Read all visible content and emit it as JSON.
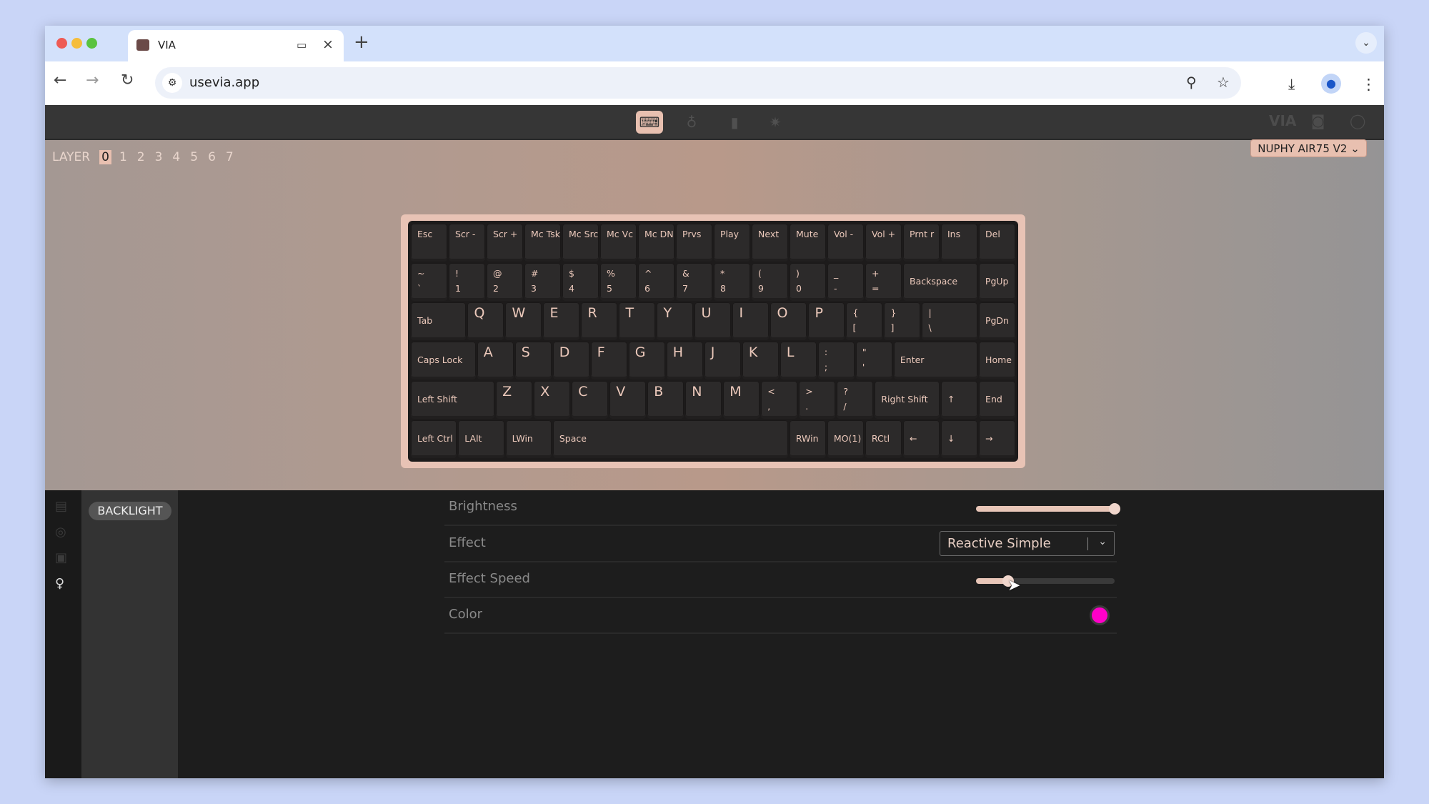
{
  "browser": {
    "tab_title": "VIA",
    "url": "usevia.app",
    "icons": {
      "new_tab": "+",
      "close": "×",
      "back": "←",
      "forward": "→",
      "reload": "↻",
      "zoom": "⚲",
      "star": "☆",
      "download": "⤓",
      "menu": "⋮",
      "tab_search": "⌄",
      "pip": "▭"
    }
  },
  "app": {
    "header_icons": [
      "keyboard-icon",
      "microphone-icon",
      "design-icon",
      "gear-icon"
    ],
    "right_labels": {
      "via": "VIA",
      "discord": "◙",
      "github": "◯"
    },
    "layer_label": "LAYER",
    "layers": [
      "0",
      "1",
      "2",
      "3",
      "4",
      "5",
      "6",
      "7"
    ],
    "active_layer": "0",
    "device": "NUPHY AIR75 V2 ⌄"
  },
  "keyboard": {
    "rows": [
      [
        {
          "t": "Esc"
        },
        {
          "t": "Scr -"
        },
        {
          "t": "Scr +"
        },
        {
          "t": "Mc Tsk"
        },
        {
          "t": "Mc Src"
        },
        {
          "t": "Mc Vc"
        },
        {
          "t": "Mc DN"
        },
        {
          "t": "Prvs"
        },
        {
          "t": "Play"
        },
        {
          "t": "Next"
        },
        {
          "t": "Mute"
        },
        {
          "t": "Vol -"
        },
        {
          "t": "Vol +"
        },
        {
          "t": "Prnt r"
        },
        {
          "t": "Ins"
        },
        {
          "t": "Del"
        }
      ],
      [
        {
          "t": "~",
          "b": "`"
        },
        {
          "t": "!",
          "b": "1"
        },
        {
          "t": "@",
          "b": "2"
        },
        {
          "t": "#",
          "b": "3"
        },
        {
          "t": "$",
          "b": "4"
        },
        {
          "t": "%",
          "b": "5"
        },
        {
          "t": "^",
          "b": "6"
        },
        {
          "t": "&",
          "b": "7"
        },
        {
          "t": "*",
          "b": "8"
        },
        {
          "t": "(",
          "b": "9"
        },
        {
          "t": ")",
          "b": "0"
        },
        {
          "t": "_",
          "b": "-"
        },
        {
          "t": "+",
          "b": "="
        },
        {
          "t": "Backspace",
          "w": 2
        },
        {
          "t": "PgUp"
        }
      ],
      [
        {
          "t": "Tab",
          "w": 1.5
        },
        {
          "t": "Q",
          "big": 1
        },
        {
          "t": "W",
          "big": 1
        },
        {
          "t": "E",
          "big": 1
        },
        {
          "t": "R",
          "big": 1
        },
        {
          "t": "T",
          "big": 1
        },
        {
          "t": "Y",
          "big": 1
        },
        {
          "t": "U",
          "big": 1
        },
        {
          "t": "I",
          "big": 1
        },
        {
          "t": "O",
          "big": 1
        },
        {
          "t": "P",
          "big": 1
        },
        {
          "t": "{",
          "b": "["
        },
        {
          "t": "}",
          "b": "]"
        },
        {
          "t": "|",
          "b": "\\",
          "w": 1.5
        },
        {
          "t": "PgDn"
        }
      ],
      [
        {
          "t": "Caps Lock",
          "w": 1.75
        },
        {
          "t": "A",
          "big": 1
        },
        {
          "t": "S",
          "big": 1
        },
        {
          "t": "D",
          "big": 1
        },
        {
          "t": "F",
          "big": 1
        },
        {
          "t": "G",
          "big": 1
        },
        {
          "t": "H",
          "big": 1
        },
        {
          "t": "J",
          "big": 1
        },
        {
          "t": "K",
          "big": 1
        },
        {
          "t": "L",
          "big": 1
        },
        {
          "t": ":",
          "b": ";"
        },
        {
          "t": "\"",
          "b": "'"
        },
        {
          "t": "Enter",
          "w": 2.25
        },
        {
          "t": "Home"
        }
      ],
      [
        {
          "t": "Left Shift",
          "w": 2.25
        },
        {
          "t": "Z",
          "big": 1
        },
        {
          "t": "X",
          "big": 1
        },
        {
          "t": "C",
          "big": 1
        },
        {
          "t": "V",
          "big": 1
        },
        {
          "t": "B",
          "big": 1
        },
        {
          "t": "N",
          "big": 1
        },
        {
          "t": "M",
          "big": 1
        },
        {
          "t": "<",
          "b": ","
        },
        {
          "t": ">",
          "b": "."
        },
        {
          "t": "?",
          "b": "/"
        },
        {
          "t": "Right Shift",
          "w": 1.75
        },
        {
          "t": "↑"
        },
        {
          "t": "End"
        }
      ],
      [
        {
          "t": "Left Ctrl",
          "w": 1.25
        },
        {
          "t": "LAlt",
          "w": 1.25
        },
        {
          "t": "LWin",
          "w": 1.25
        },
        {
          "t": "Space",
          "w": 6.25
        },
        {
          "t": "RWin"
        },
        {
          "t": "MO(1)"
        },
        {
          "t": "RCtl"
        },
        {
          "t": "←"
        },
        {
          "t": "↓"
        },
        {
          "t": "→"
        }
      ]
    ]
  },
  "panel": {
    "rail_icons": [
      "keymap-icon",
      "macro-icon",
      "save-icon",
      "lightbulb-icon"
    ],
    "submenu": "BACKLIGHT",
    "brightness": {
      "label": "Brightness",
      "value_percent": 100
    },
    "effect": {
      "label": "Effect",
      "value": "Reactive Simple"
    },
    "effect_speed": {
      "label": "Effect Speed",
      "value_percent": 23
    },
    "color": {
      "label": "Color",
      "value": "#ff00c8"
    }
  }
}
